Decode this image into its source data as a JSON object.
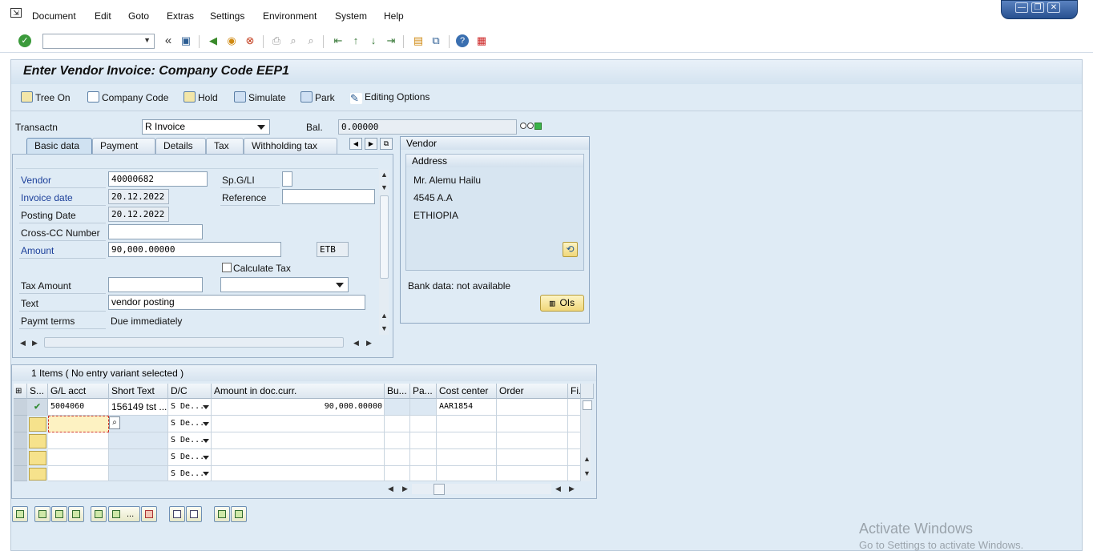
{
  "menu": {
    "items": [
      "Document",
      "Edit",
      "Goto",
      "Extras",
      "Settings",
      "Environment",
      "System",
      "Help"
    ]
  },
  "window_controls": {
    "minimize": "—",
    "restore": "❐",
    "close": "✕"
  },
  "toolbar": {
    "command_field_value": "",
    "icons": [
      "enter-icon",
      "save-icon",
      "back-icon",
      "exit-icon",
      "cancel-icon",
      "print-icon",
      "find-icon",
      "find-next-icon",
      "first-page-icon",
      "previous-page-icon",
      "next-page-icon",
      "last-page-icon",
      "create-session-icon",
      "shortcut-icon",
      "help-icon",
      "customize-layout-icon"
    ]
  },
  "title": "Enter Vendor Invoice: Company Code EEP1",
  "app_toolbar": {
    "tree_on": "Tree On",
    "company_code": "Company Code",
    "hold": "Hold",
    "simulate": "Simulate",
    "park": "Park",
    "editing_options": "Editing Options"
  },
  "header": {
    "transaction_label": "Transactn",
    "transaction_value": "R Invoice",
    "balance_label": "Bal.",
    "balance_value": "0.00000",
    "status_colors": {
      "red": "#ffffff",
      "yellow": "#ffffff",
      "green": "#39b54a"
    }
  },
  "tabs": [
    "Basic data",
    "Payment",
    "Details",
    "Tax",
    "Withholding tax"
  ],
  "active_tab": "Basic data",
  "basic_data": {
    "vendor_label": "Vendor",
    "vendor_value": "40000682",
    "spgl_label": "Sp.G/LI",
    "spgl_value": "",
    "invoice_date_label": "Invoice date",
    "invoice_date_value": "20.12.2022",
    "reference_label": "Reference",
    "reference_value": "",
    "posting_date_label": "Posting Date",
    "posting_date_value": "20.12.2022",
    "cross_cc_label": "Cross-CC Number",
    "cross_cc_value": "",
    "amount_label": "Amount",
    "amount_value": "90,000.00000",
    "currency_value": "ETB",
    "calculate_tax_label": "Calculate Tax",
    "calculate_tax_checked": false,
    "tax_amount_label": "Tax Amount",
    "tax_amount_value": "",
    "tax_code_value": "",
    "text_label": "Text",
    "text_value": "vendor posting",
    "payment_terms_label": "Paymt terms",
    "payment_terms_value": "Due immediately"
  },
  "vendor_panel": {
    "title": "Vendor",
    "address_title": "Address",
    "address_lines": [
      "Mr. Alemu Hailu",
      "4545 A.A",
      "ETHIOPIA"
    ],
    "bank_data": "Bank data: not available",
    "ois_button": "OIs"
  },
  "items": {
    "title": "1 Items ( No entry variant selected )",
    "columns": [
      "S...",
      "G/L acct",
      "Short Text",
      "D/C",
      "Amount in doc.curr.",
      "Bu...",
      "Pa...",
      "Cost center",
      "Order",
      "Fi."
    ],
    "rows": [
      {
        "status": "ok",
        "gl": "5004060",
        "short_text": "156149 tst ...",
        "dc": "S De...",
        "amount": "90,000.00000",
        "bu": "",
        "pa": "",
        "cost_center": "AAR1854",
        "order": ""
      },
      {
        "status": "",
        "gl": "",
        "short_text": "",
        "dc": "S De...",
        "amount": "",
        "bu": "",
        "pa": "",
        "cost_center": "",
        "order": ""
      },
      {
        "status": "",
        "gl": "",
        "short_text": "",
        "dc": "S De...",
        "amount": "",
        "bu": "",
        "pa": "",
        "cost_center": "",
        "order": ""
      },
      {
        "status": "",
        "gl": "",
        "short_text": "",
        "dc": "S De...",
        "amount": "",
        "bu": "",
        "pa": "",
        "cost_center": "",
        "order": ""
      },
      {
        "status": "",
        "gl": "",
        "short_text": "",
        "dc": "S De...",
        "amount": "",
        "bu": "",
        "pa": "",
        "cost_center": "",
        "order": ""
      }
    ]
  },
  "watermark": {
    "line1": "Activate Windows",
    "line2": "Go to Settings to activate Windows."
  }
}
